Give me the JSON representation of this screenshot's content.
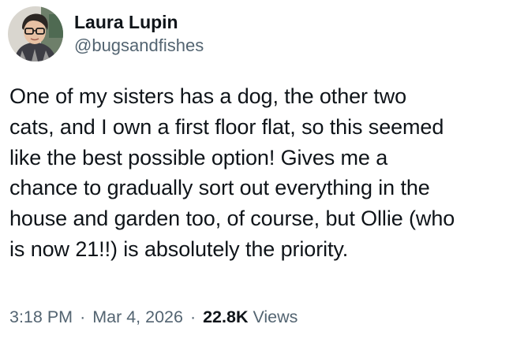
{
  "author": {
    "display_name": "Laura Lupin",
    "handle": "@bugsandfishes"
  },
  "tweet": {
    "text": "One of my sisters has a dog, the other two\ncats, and I own a first floor flat, so this seemed\nlike the best possible option! Gives me a\nchance to gradually sort out everything in the\nhouse and garden too, of course, but Ollie (who\nis now 21!!) is absolutely the priority."
  },
  "meta": {
    "time": "3:18 PM",
    "separator": "·",
    "date": "Mar 4, 2026",
    "views_count": "22.8K",
    "views_label": "Views"
  }
}
